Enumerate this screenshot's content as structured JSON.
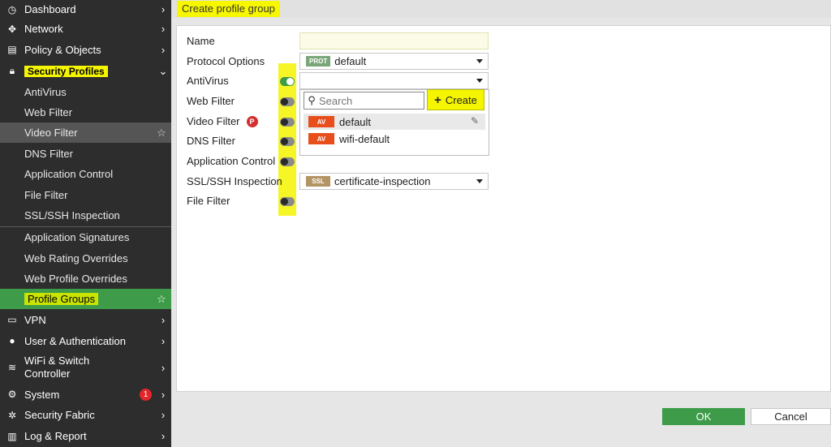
{
  "sidebar": {
    "items": [
      {
        "label": "Dashboard",
        "icon": "dashboard-icon"
      },
      {
        "label": "Network",
        "icon": "network-icon"
      },
      {
        "label": "Policy & Objects",
        "icon": "policy-icon"
      },
      {
        "label": "Security Profiles",
        "icon": "lock-icon"
      },
      {
        "label": "VPN",
        "icon": "laptop-icon"
      },
      {
        "label": "User & Authentication",
        "icon": "user-icon"
      },
      {
        "label": "WiFi & Switch Controller",
        "icon": "wifi-icon"
      },
      {
        "label": "System",
        "icon": "gear-icon",
        "badge": "1"
      },
      {
        "label": "Security Fabric",
        "icon": "fabric-icon"
      },
      {
        "label": "Log & Report",
        "icon": "chart-icon"
      }
    ],
    "sub_items": [
      "AntiVirus",
      "Web Filter",
      "Video Filter",
      "DNS Filter",
      "Application Control",
      "File Filter",
      "SSL/SSH Inspection",
      "Application Signatures",
      "Web Rating Overrides",
      "Web Profile Overrides",
      "Profile Groups"
    ]
  },
  "page": {
    "title": "Create profile group"
  },
  "form": {
    "name_label": "Name",
    "name_value": "",
    "protocol_label": "Protocol Options",
    "protocol_tag": "PROT",
    "protocol_value": "default",
    "antivirus_label": "AntiVirus",
    "webfilter_label": "Web Filter",
    "videofilter_label": "Video Filter",
    "videofilter_badge": "P",
    "dnsfilter_label": "DNS Filter",
    "appcontrol_label": "Application Control",
    "ssl_label": "SSL/SSH Inspection",
    "ssl_tag": "SSL",
    "ssl_value": "certificate-inspection",
    "filefilter_label": "File Filter"
  },
  "dropdown": {
    "search_placeholder": "Search",
    "create_label": "Create",
    "options": [
      {
        "tag": "AV",
        "label": "default"
      },
      {
        "tag": "AV",
        "label": "wifi-default"
      }
    ]
  },
  "footer": {
    "ok_label": "OK",
    "cancel_label": "Cancel"
  },
  "colors": {
    "accent": "#3e9b4a",
    "highlight": "#f5f500",
    "sidebar": "#2d2d2d",
    "av_tag": "#e84d1c"
  }
}
